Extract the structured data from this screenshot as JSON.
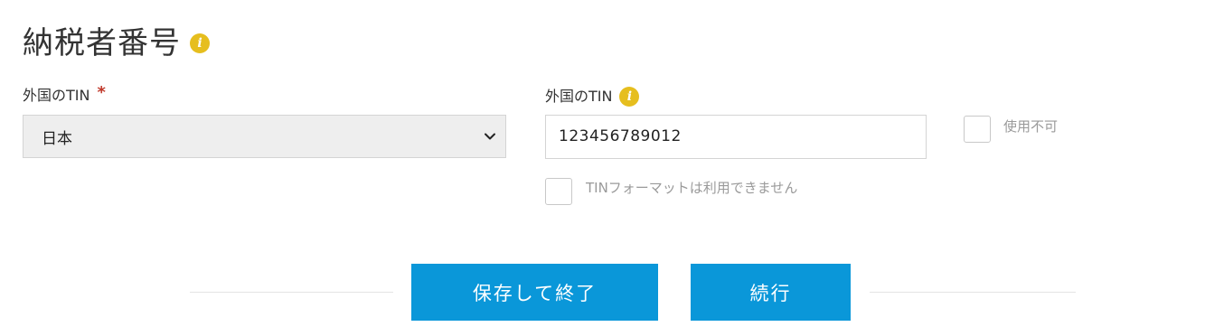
{
  "section": {
    "title": "納税者番号",
    "info_icon_glyph": "i"
  },
  "tin_country": {
    "label": "外国のTIN",
    "required_marker": "*",
    "selected_value": "日本"
  },
  "tin_number": {
    "label": "外国のTIN",
    "info_icon_glyph": "i",
    "value": "123456789012"
  },
  "unavailable": {
    "label": "使用不可",
    "checked": false
  },
  "tin_format": {
    "label": "TINフォーマットは利用できません",
    "checked": false
  },
  "actions": {
    "save_exit_label": "保存して終了",
    "continue_label": "続行"
  },
  "colors": {
    "accent": "#0a97d9",
    "info": "#e6be1e",
    "required": "#c0392b"
  },
  "icons": [
    "info-icon",
    "chevron-down-icon"
  ]
}
